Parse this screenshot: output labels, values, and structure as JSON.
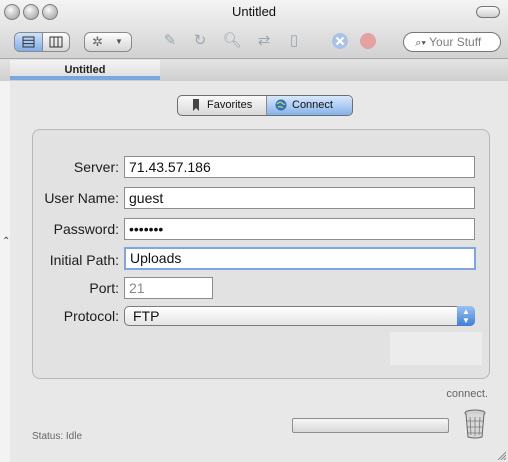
{
  "window": {
    "title": "Untitled"
  },
  "toolbar": {
    "search_placeholder": "Your Stuff",
    "icons": [
      "list-view-icon",
      "column-view-icon",
      "gear-icon",
      "dropdown-arrow-icon",
      "edit-icon",
      "refresh-icon",
      "get-info-icon",
      "sync-icon",
      "document-icon",
      "disconnect-icon",
      "stop-icon",
      "search-icon"
    ]
  },
  "tab": {
    "label": "Untitled"
  },
  "segmented": {
    "favorites_label": "Favorites",
    "connect_label": "Connect",
    "selected": "Connect"
  },
  "form": {
    "server_label": "Server:",
    "server_value": "71.43.57.186",
    "username_label": "User Name:",
    "username_value": "guest",
    "password_label": "Password:",
    "password_value": "•••••••",
    "initial_path_label": "Initial Path:",
    "initial_path_value": "Uploads",
    "port_label": "Port:",
    "port_value": "21",
    "protocol_label": "Protocol:",
    "protocol_value": "FTP"
  },
  "footer": {
    "connect_text": "connect.",
    "status_text": "Status: Idle"
  },
  "colors": {
    "accent_blue": "#7da6e3",
    "close_red": "#d9534f"
  }
}
